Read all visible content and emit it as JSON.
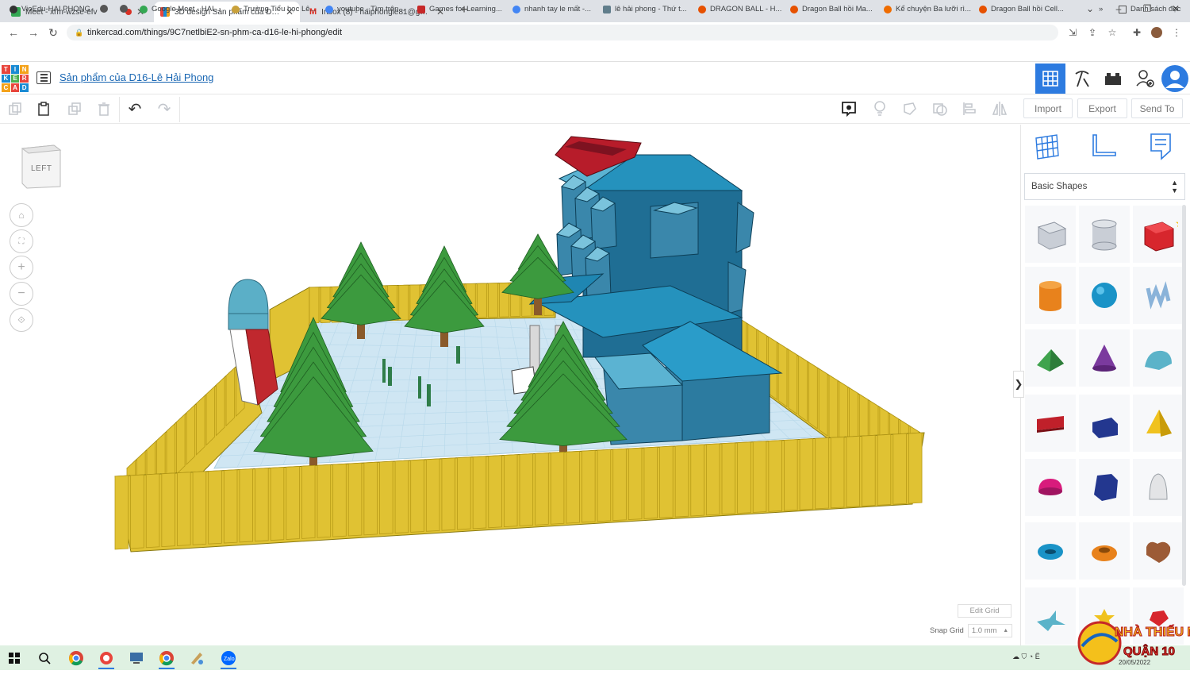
{
  "browser": {
    "tabs": [
      {
        "title": "Meet - xrm-wzse-efv",
        "active": false,
        "favicon_color": "#34a853"
      },
      {
        "title": "3D design Sản phẩm của D16-Lê",
        "active": true,
        "favicon_color": "#e8453c"
      },
      {
        "title": "Inbox (8) - haiphongle81@gmail",
        "active": false,
        "favicon_color": "#d93025"
      }
    ],
    "url": "tinkercad.com/things/9C7netlbiE2-sn-phm-ca-d16-le-hi-phong/edit",
    "bookmarks": [
      "VioEdu-HAI PHONG",
      "Google Meet - HAI...",
      "Trường Tiểu học Lê...",
      "youtube - Tìm trên...",
      "Games for Learning...",
      "nhanh tay le mất -...",
      "lê hải phong - Thứ t...",
      "DRAGON BALL - H...",
      "Dragon Ball hồi Ma...",
      "Kể chuyện Ba lưỡi rì...",
      "Dragon Ball hồi Cell..."
    ],
    "reading_list": "Danh sách đọc",
    "overflow": "»"
  },
  "app": {
    "logo_letters": [
      "T",
      "I",
      "N",
      "K",
      "E",
      "R",
      "C",
      "A",
      "D"
    ],
    "project_title": "Sản phẩm của D16-Lê Hải Phong",
    "actions": {
      "import": "Import",
      "export": "Export",
      "send_to": "Send To"
    },
    "viewcube_label": "LEFT",
    "shape_category": "Basic Shapes",
    "edit_grid": "Edit Grid",
    "snap_grid_label": "Snap Grid",
    "snap_grid_value": "1.0 mm",
    "collapse_glyph": "❯"
  },
  "colors": {
    "accent": "#1a67b3",
    "fence": "#e0c233",
    "fence_dark": "#b89b17",
    "house": "#1f6e94",
    "roof": "#2196c4",
    "tree": "#3c9a3e",
    "trunk": "#8a5a2b",
    "ground": "#cfe6f3",
    "taskbar": "#dff1e2"
  },
  "taskbar": {
    "date": "20/05/2022"
  },
  "watermark": {
    "line1": "NHÀ THIẾU NHI",
    "line2": "QUẬN 10"
  }
}
